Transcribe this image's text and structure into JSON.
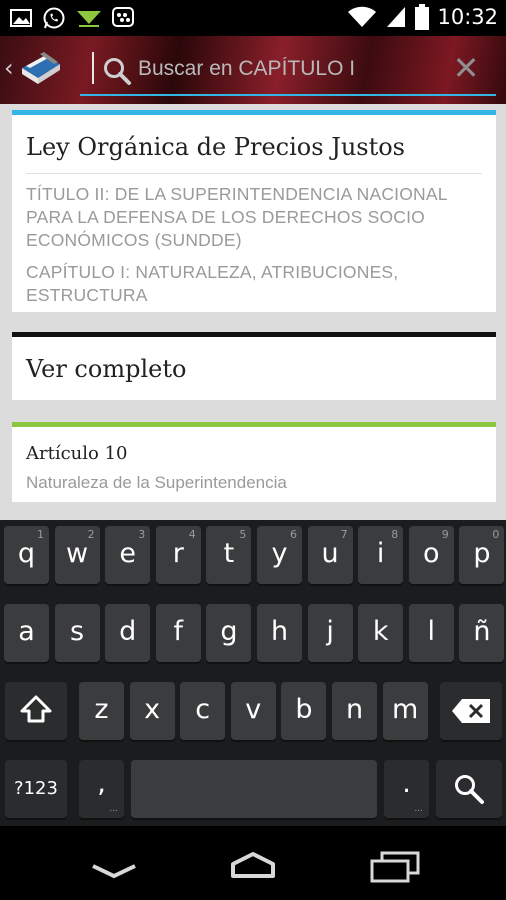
{
  "status_bar": {
    "time": "10:32",
    "icons": [
      "gallery-icon",
      "whatsapp-icon",
      "download-icon",
      "bbm-icon",
      "wifi-icon",
      "signal-icon",
      "battery-icon"
    ]
  },
  "action_bar": {
    "search_placeholder": "Buscar en CAPÍTULO I",
    "search_value": "",
    "clear_glyph": "✕",
    "accent": "#33b5e5"
  },
  "cards": {
    "header": {
      "title": "Ley Orgánica de Precios Justos",
      "line1": "TÍTULO II: DE LA SUPERINTENDENCIA NACIONAL PARA LA DEFENSA DE LOS DERECHOS SOCIO ECONÓMICOS (SUNDDE)",
      "line2": "CAPÍTULO I: NATURALEZA, ATRIBUCIONES, ESTRUCTURA",
      "accent": "#33b5e5"
    },
    "view_full": {
      "label": "Ver completo",
      "accent": "#111111"
    },
    "article": {
      "title": "Artículo 10",
      "subtitle": "Naturaleza de la Superintendencia",
      "accent": "#8dc63f"
    }
  },
  "keyboard": {
    "row1": [
      {
        "ch": "q",
        "n": "1"
      },
      {
        "ch": "w",
        "n": "2"
      },
      {
        "ch": "e",
        "n": "3"
      },
      {
        "ch": "r",
        "n": "4"
      },
      {
        "ch": "t",
        "n": "5"
      },
      {
        "ch": "y",
        "n": "6"
      },
      {
        "ch": "u",
        "n": "7"
      },
      {
        "ch": "i",
        "n": "8"
      },
      {
        "ch": "o",
        "n": "9"
      },
      {
        "ch": "p",
        "n": "0"
      }
    ],
    "row2": [
      "a",
      "s",
      "d",
      "f",
      "g",
      "h",
      "j",
      "k",
      "l",
      "ñ"
    ],
    "row3": [
      "z",
      "x",
      "c",
      "v",
      "b",
      "n",
      "m"
    ],
    "symbols_label": "?123",
    "comma": ",",
    "period": "."
  }
}
